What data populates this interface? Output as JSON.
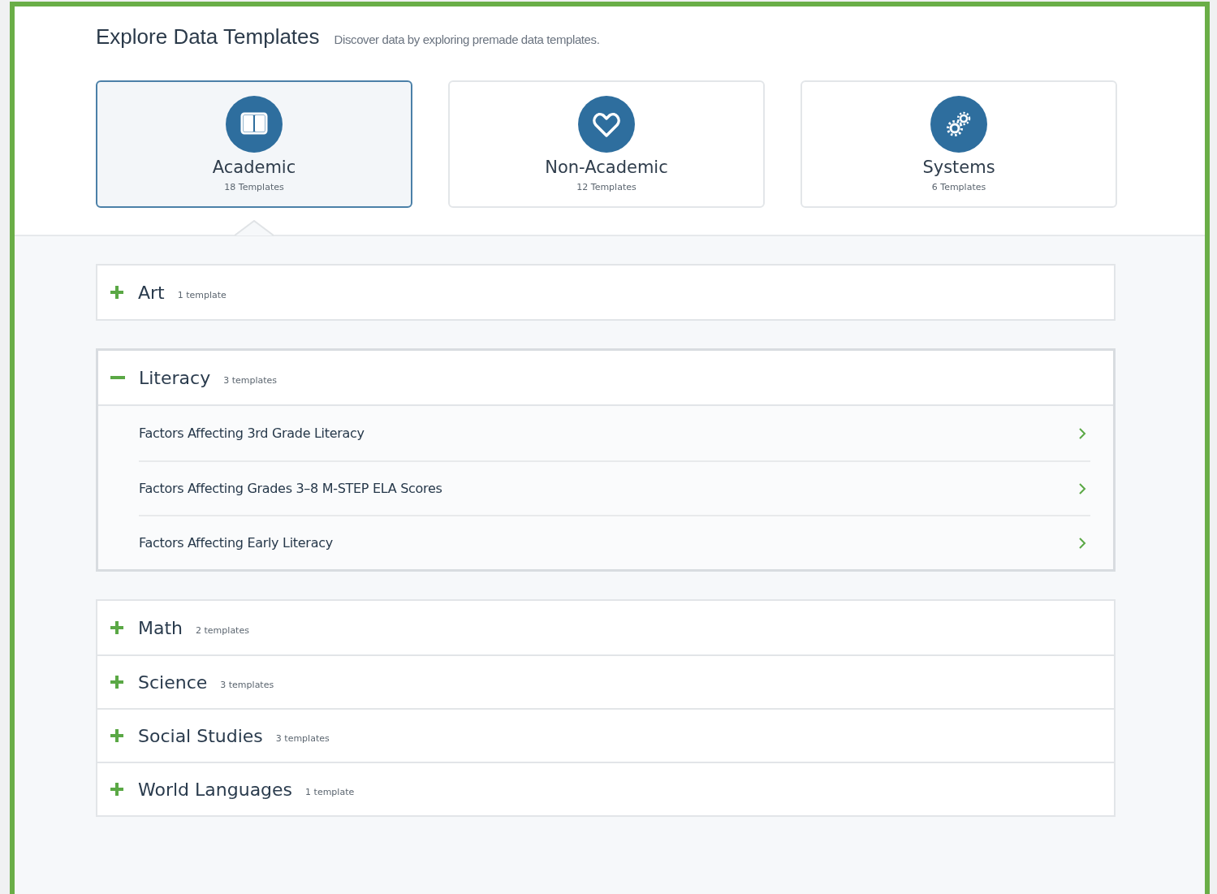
{
  "header": {
    "title": "Explore Data Templates",
    "subtitle": "Discover data by exploring premade data templates."
  },
  "cards": [
    {
      "kind": "book",
      "label": "Academic",
      "count": "18 Templates",
      "selected": true
    },
    {
      "kind": "heart",
      "label": "Non-Academic",
      "count": "12 Templates",
      "selected": false
    },
    {
      "kind": "gears",
      "label": "Systems",
      "count": "6 Templates",
      "selected": false
    }
  ],
  "groups": [
    {
      "categories": [
        {
          "name": "Art",
          "count": "1 template",
          "expanded": false
        }
      ]
    },
    {
      "categories": [
        {
          "name": "Literacy",
          "count": "3 templates",
          "expanded": true,
          "templates": [
            "Factors Affecting 3rd Grade Literacy",
            "Factors Affecting Grades 3–8 M-STEP ELA Scores",
            "Factors Affecting Early Literacy"
          ]
        }
      ]
    },
    {
      "categories": [
        {
          "name": "Math",
          "count": "2 templates",
          "expanded": false
        },
        {
          "name": "Science",
          "count": "3 templates",
          "expanded": false
        },
        {
          "name": "Social Studies",
          "count": "3 templates",
          "expanded": false
        },
        {
          "name": "World Languages",
          "count": "1 template",
          "expanded": false
        }
      ]
    }
  ]
}
